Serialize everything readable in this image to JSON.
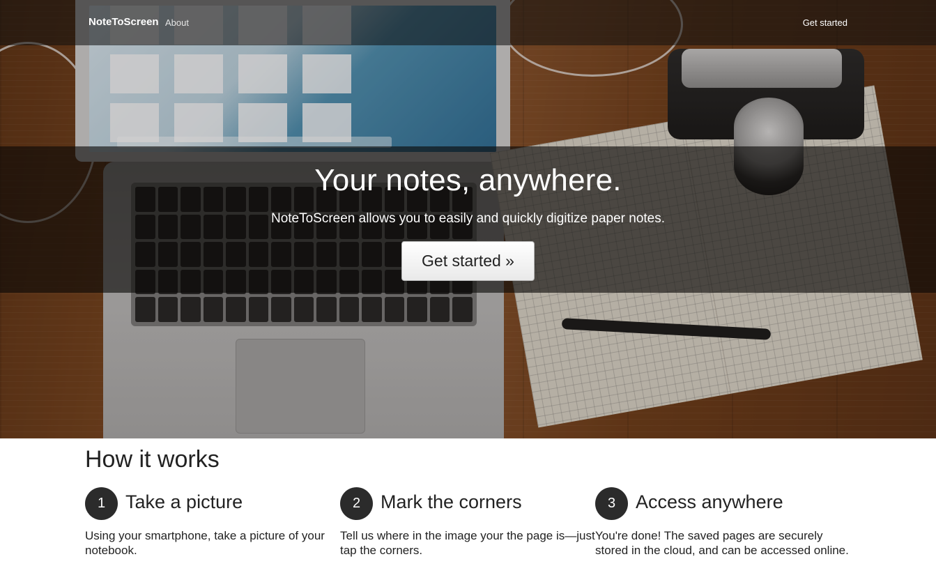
{
  "navbar": {
    "brand": "NoteToScreen",
    "about": "About",
    "get_started": "Get started"
  },
  "hero": {
    "title": "Your notes, anywhere.",
    "subtitle": "NoteToScreen allows you to easily and quickly digitize paper notes.",
    "button_label": "Get started »"
  },
  "how": {
    "title": "How it works",
    "steps": [
      {
        "number": "1",
        "heading": "Take a picture",
        "text": "Using your smartphone, take a picture of your notebook."
      },
      {
        "number": "2",
        "heading": "Mark the corners",
        "text": "Tell us where in the image your the page is—just tap the corners."
      },
      {
        "number": "3",
        "heading": "Access anywhere",
        "text": "You're done! The saved pages are securely stored in the cloud, and can be accessed online."
      }
    ]
  },
  "colors": {
    "overlay_band": "#0a0806",
    "step_circle": "#2b2b2b",
    "button_bg": "#ffffff"
  }
}
